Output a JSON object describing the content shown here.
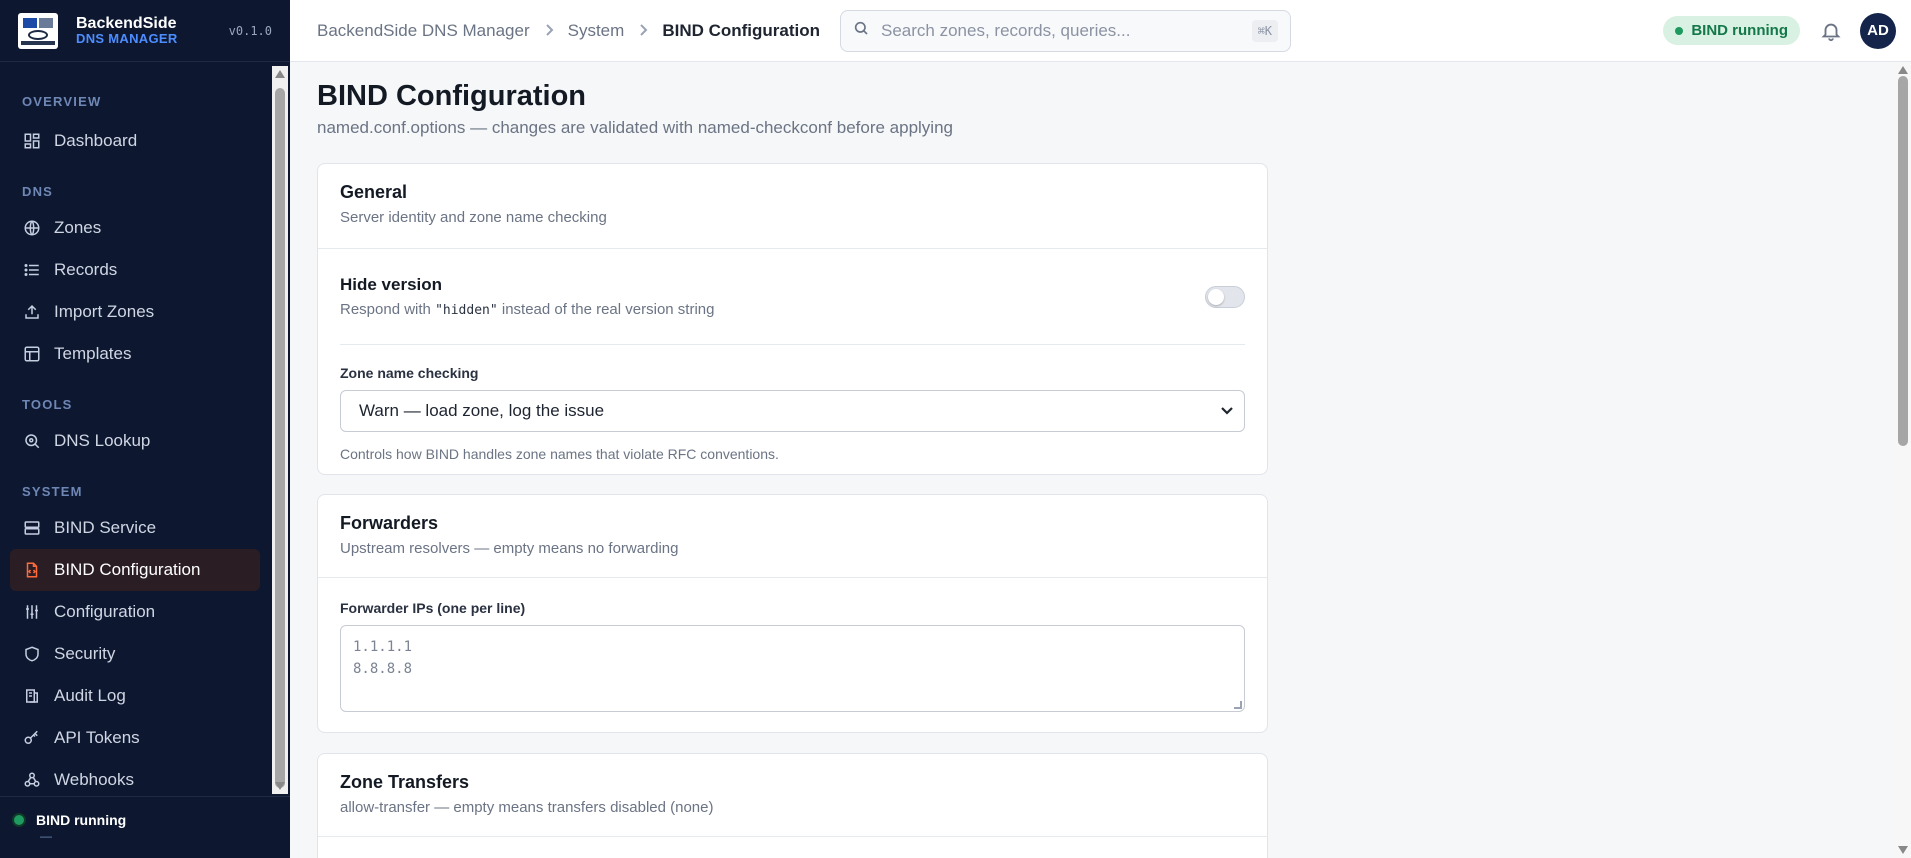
{
  "brand": {
    "name": "BackendSide",
    "subtitle": "DNS MANAGER",
    "version": "v0.1.0"
  },
  "sidebar": {
    "sections": [
      {
        "title": "OVERVIEW",
        "items": [
          {
            "label": "Dashboard",
            "icon": "dashboard-icon"
          }
        ]
      },
      {
        "title": "DNS",
        "items": [
          {
            "label": "Zones",
            "icon": "globe-icon"
          },
          {
            "label": "Records",
            "icon": "list-icon"
          },
          {
            "label": "Import Zones",
            "icon": "upload-icon"
          },
          {
            "label": "Templates",
            "icon": "template-icon"
          }
        ]
      },
      {
        "title": "TOOLS",
        "items": [
          {
            "label": "DNS Lookup",
            "icon": "magnifier-icon"
          }
        ]
      },
      {
        "title": "SYSTEM",
        "items": [
          {
            "label": "BIND Service",
            "icon": "server-icon"
          },
          {
            "label": "BIND Configuration",
            "icon": "file-code-icon",
            "active": true
          },
          {
            "label": "Configuration",
            "icon": "sliders-icon"
          },
          {
            "label": "Security",
            "icon": "shield-icon"
          },
          {
            "label": "Audit Log",
            "icon": "audit-icon"
          },
          {
            "label": "API Tokens",
            "icon": "key-icon"
          },
          {
            "label": "Webhooks",
            "icon": "webhook-icon"
          }
        ]
      }
    ],
    "status": {
      "label": "BIND running",
      "sub": "—"
    }
  },
  "header": {
    "breadcrumbs": [
      "BackendSide DNS Manager",
      "System",
      "BIND Configuration"
    ],
    "search_placeholder": "Search zones, records, queries...",
    "search_shortcut": "⌘K",
    "status_pill": "BIND running",
    "avatar_initials": "AD"
  },
  "page": {
    "title": "BIND Configuration",
    "subtitle": "named.conf.options — changes are validated with named-checkconf before applying"
  },
  "cards": {
    "general": {
      "title": "General",
      "desc": "Server identity and zone name checking",
      "hide_version": {
        "label": "Hide version",
        "desc_prefix": "Respond with ",
        "desc_code": "\"hidden\"",
        "desc_suffix": " instead of the real version string",
        "enabled": false
      },
      "zone_name_checking": {
        "label": "Zone name checking",
        "selected": "Warn — load zone, log the issue",
        "hint": "Controls how BIND handles zone names that violate RFC conventions."
      }
    },
    "forwarders": {
      "title": "Forwarders",
      "desc": "Upstream resolvers — empty means no forwarding",
      "field_label": "Forwarder IPs (one per line)",
      "placeholder_lines": [
        "1.1.1.1",
        "8.8.8.8"
      ]
    },
    "zone_transfers": {
      "title": "Zone Transfers",
      "desc": "allow-transfer — empty means transfers disabled (none)"
    }
  },
  "colors": {
    "accent": "#ff6a3a",
    "sidebar_bg": "#0d1830",
    "status_green": "#1e9a5e",
    "brand_blue": "#4d8dff"
  }
}
